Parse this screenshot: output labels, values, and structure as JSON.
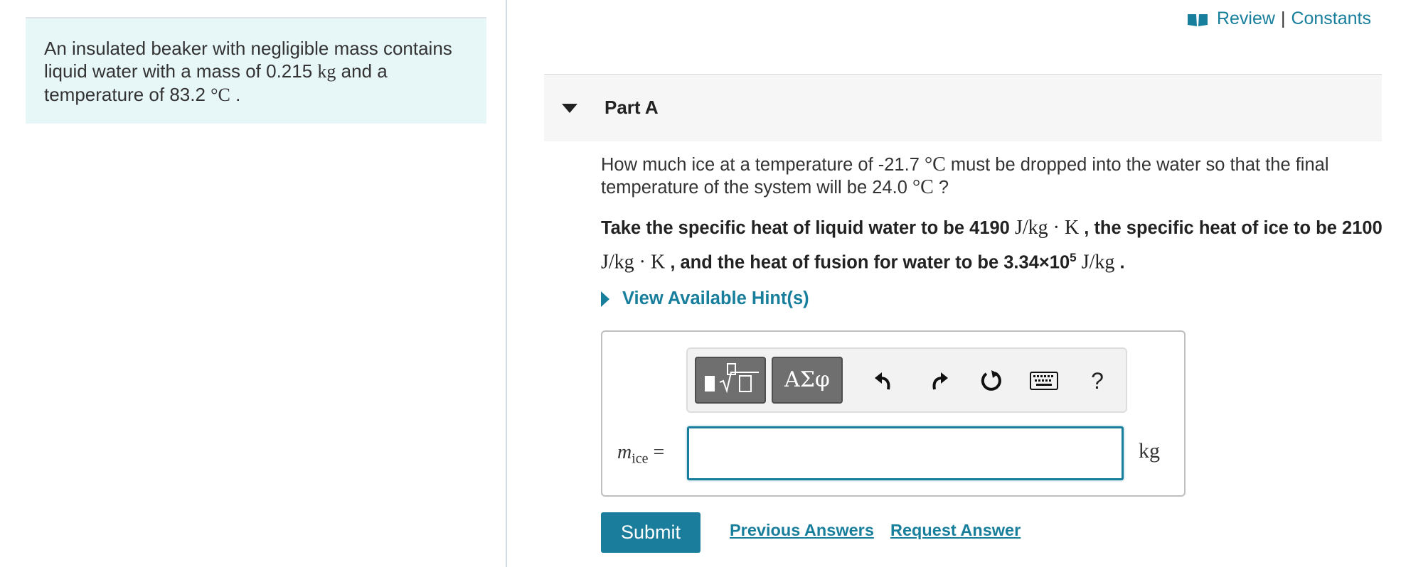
{
  "problem": {
    "text_1": "An insulated beaker with negligible mass contains liquid water with a mass of 0.215 ",
    "unit_kg": "kg",
    "text_2": " and a temperature of 83.2 ",
    "unit_c": "°C",
    "text_3": " ."
  },
  "header": {
    "review_label": "Review",
    "separator": "|",
    "constants_label": "Constants"
  },
  "part": {
    "title": "Part A"
  },
  "question": {
    "q1": "How much ice at a temperature of -21.7 ",
    "unit_c1": "°C",
    "q2": " must be dropped into the water so that the final temperature of the system will be 24.0 ",
    "unit_c2": "°C",
    "q3": " ?"
  },
  "instructions": {
    "t1": "Take the specific heat of liquid water to be 4190 ",
    "u1": "J/kg · K",
    "t2": " , the specific heat of ice to be 2100 ",
    "u2": "J/kg · K",
    "t3": " , and the heat of fusion for water to be 3.34×10",
    "exp": "5",
    "u3": "J/kg",
    "t4": " ."
  },
  "hint": {
    "label": "View Available Hint(s)"
  },
  "toolbar": {
    "greek_label": "ΑΣφ",
    "help_label": "?"
  },
  "answer": {
    "var": "m",
    "sub": "ice",
    "eq": " =",
    "value": "",
    "unit": "kg"
  },
  "actions": {
    "submit_label": "Submit",
    "previous_label": "Previous Answers",
    "request_label": "Request Answer"
  }
}
